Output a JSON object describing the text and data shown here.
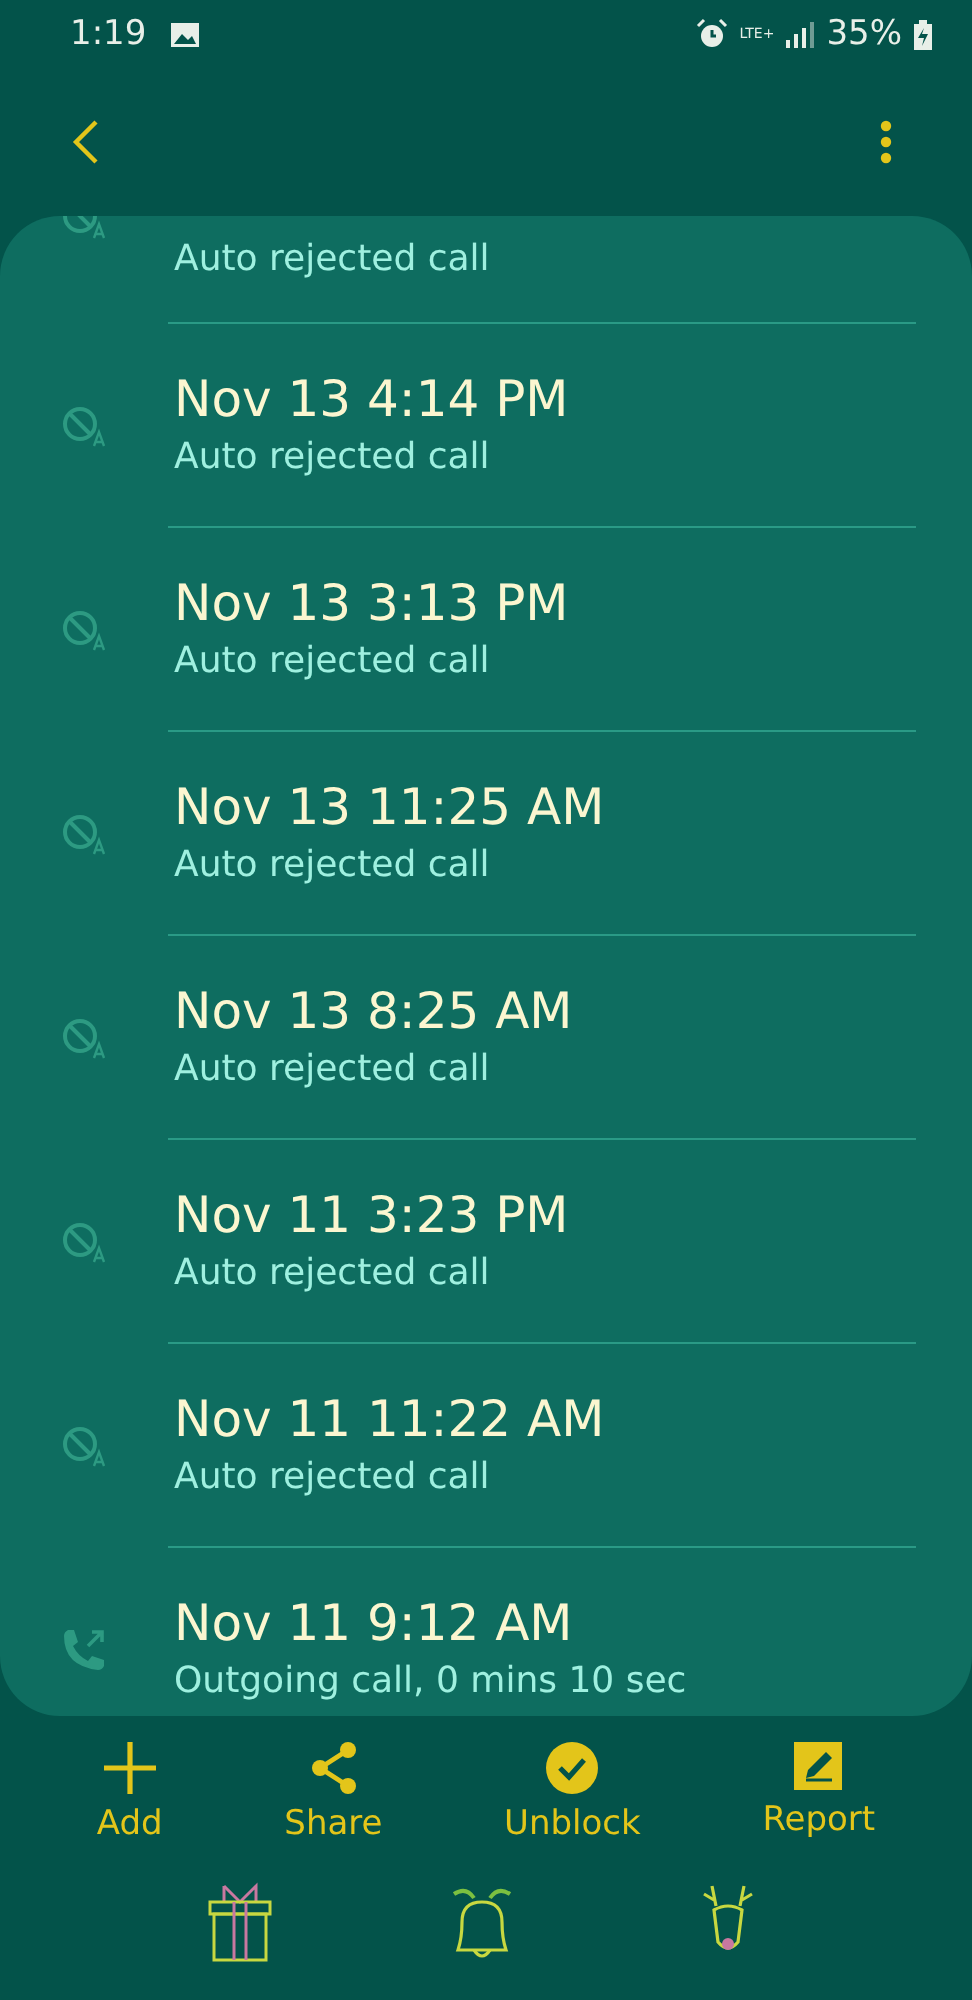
{
  "status_bar": {
    "time": "1:19",
    "network": "LTE+",
    "battery": "35%"
  },
  "calls": [
    {
      "kind": "rejected",
      "subtitle": "Auto rejected call"
    },
    {
      "kind": "rejected",
      "title": "Nov 13 4:14 PM",
      "subtitle": "Auto rejected call"
    },
    {
      "kind": "rejected",
      "title": "Nov 13 3:13 PM",
      "subtitle": "Auto rejected call"
    },
    {
      "kind": "rejected",
      "title": "Nov 13 11:25 AM",
      "subtitle": "Auto rejected call"
    },
    {
      "kind": "rejected",
      "title": "Nov 13 8:25 AM",
      "subtitle": "Auto rejected call"
    },
    {
      "kind": "rejected",
      "title": "Nov 11 3:23 PM",
      "subtitle": "Auto rejected call"
    },
    {
      "kind": "rejected",
      "title": "Nov 11 11:22 AM",
      "subtitle": "Auto rejected call"
    },
    {
      "kind": "outgoing",
      "title": "Nov 11 9:12 AM",
      "subtitle": "Outgoing call, 0 mins 10 sec"
    }
  ],
  "actions": [
    {
      "kind": "add",
      "label": "Add"
    },
    {
      "kind": "share",
      "label": "Share"
    },
    {
      "kind": "unblock",
      "label": "Unblock"
    },
    {
      "kind": "report",
      "label": "Report"
    }
  ]
}
